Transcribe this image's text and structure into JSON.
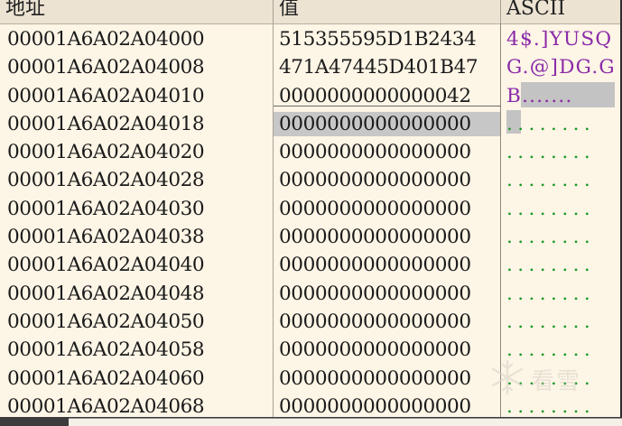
{
  "columns": {
    "address": "地址",
    "value": "值",
    "ascii": "ASCII"
  },
  "rows": [
    {
      "address": "00001A6A02A04000",
      "value": "515355595D1B2434",
      "ascii": "4$.]YUSQ",
      "ascii_style": "purple"
    },
    {
      "address": "00001A6A02A04008",
      "value": "471A47445D401B47",
      "ascii": "G.@]DG.G",
      "ascii_style": "purple"
    },
    {
      "address": "00001A6A02A04010",
      "value": "0000000000000042",
      "ascii": "B.......",
      "ascii_style": "purple"
    },
    {
      "address": "00001A6A02A04018",
      "value": "0000000000000000",
      "ascii": "........",
      "ascii_style": "green",
      "selected": true
    },
    {
      "address": "00001A6A02A04020",
      "value": "0000000000000000",
      "ascii": "........",
      "ascii_style": "green"
    },
    {
      "address": "00001A6A02A04028",
      "value": "0000000000000000",
      "ascii": "........",
      "ascii_style": "green"
    },
    {
      "address": "00001A6A02A04030",
      "value": "0000000000000000",
      "ascii": "........",
      "ascii_style": "green"
    },
    {
      "address": "00001A6A02A04038",
      "value": "0000000000000000",
      "ascii": "........",
      "ascii_style": "green"
    },
    {
      "address": "00001A6A02A04040",
      "value": "0000000000000000",
      "ascii": "........",
      "ascii_style": "green"
    },
    {
      "address": "00001A6A02A04048",
      "value": "0000000000000000",
      "ascii": "........",
      "ascii_style": "green"
    },
    {
      "address": "00001A6A02A04050",
      "value": "0000000000000000",
      "ascii": "........",
      "ascii_style": "green"
    },
    {
      "address": "00001A6A02A04058",
      "value": "0000000000000000",
      "ascii": "........",
      "ascii_style": "green"
    },
    {
      "address": "00001A6A02A04060",
      "value": "0000000000000000",
      "ascii": "........",
      "ascii_style": "green"
    },
    {
      "address": "00001A6A02A04068",
      "value": "0000000000000000",
      "ascii": "........",
      "ascii_style": "green"
    }
  ],
  "watermark": {
    "text": "看雪",
    "icon": "snowflake-logo-icon"
  },
  "colors": {
    "background": "#fdf5e6",
    "ascii_printable": "#8a2aa8",
    "ascii_null": "#1a9a2a",
    "selection": "#c7c7c7"
  }
}
